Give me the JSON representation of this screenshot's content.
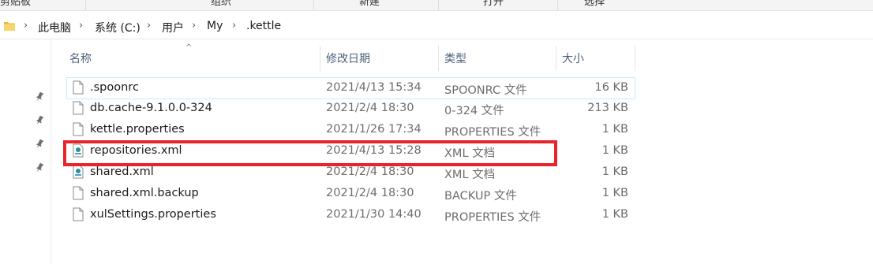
{
  "ribbon": {
    "items": [
      "剪贴板",
      "组织",
      "新建",
      "打开",
      "选择"
    ]
  },
  "address": {
    "crumbs": [
      "此电脑",
      "系统 (C:)",
      "用户",
      "My",
      ".kettle"
    ]
  },
  "columns": {
    "name": "名称",
    "date": "修改日期",
    "type": "类型",
    "size": "大小"
  },
  "files": [
    {
      "name": ".spoonrc",
      "date": "2021/4/13 15:34",
      "type": "SPOONRC 文件",
      "size": "16 KB",
      "icon": "generic-file-icon"
    },
    {
      "name": "db.cache-9.1.0.0-324",
      "date": "2021/2/4 18:30",
      "type": "0-324 文件",
      "size": "213 KB",
      "icon": "generic-file-icon"
    },
    {
      "name": "kettle.properties",
      "date": "2021/1/26 17:34",
      "type": "PROPERTIES 文件",
      "size": "1 KB",
      "icon": "generic-file-icon"
    },
    {
      "name": "repositories.xml",
      "date": "2021/4/13 15:28",
      "type": "XML 文档",
      "size": "1 KB",
      "icon": "xml-file-icon"
    },
    {
      "name": "shared.xml",
      "date": "2021/2/4 18:30",
      "type": "XML 文档",
      "size": "1 KB",
      "icon": "xml-file-icon"
    },
    {
      "name": "shared.xml.backup",
      "date": "2021/2/4 18:30",
      "type": "BACKUP 文件",
      "size": "1 KB",
      "icon": "generic-file-icon"
    },
    {
      "name": "xulSettings.properties",
      "date": "2021/1/30 14:40",
      "type": "PROPERTIES 文件",
      "size": "1 KB",
      "icon": "generic-file-icon"
    }
  ],
  "highlight_color": "#e8232b",
  "selection_color": "#cce8ff"
}
